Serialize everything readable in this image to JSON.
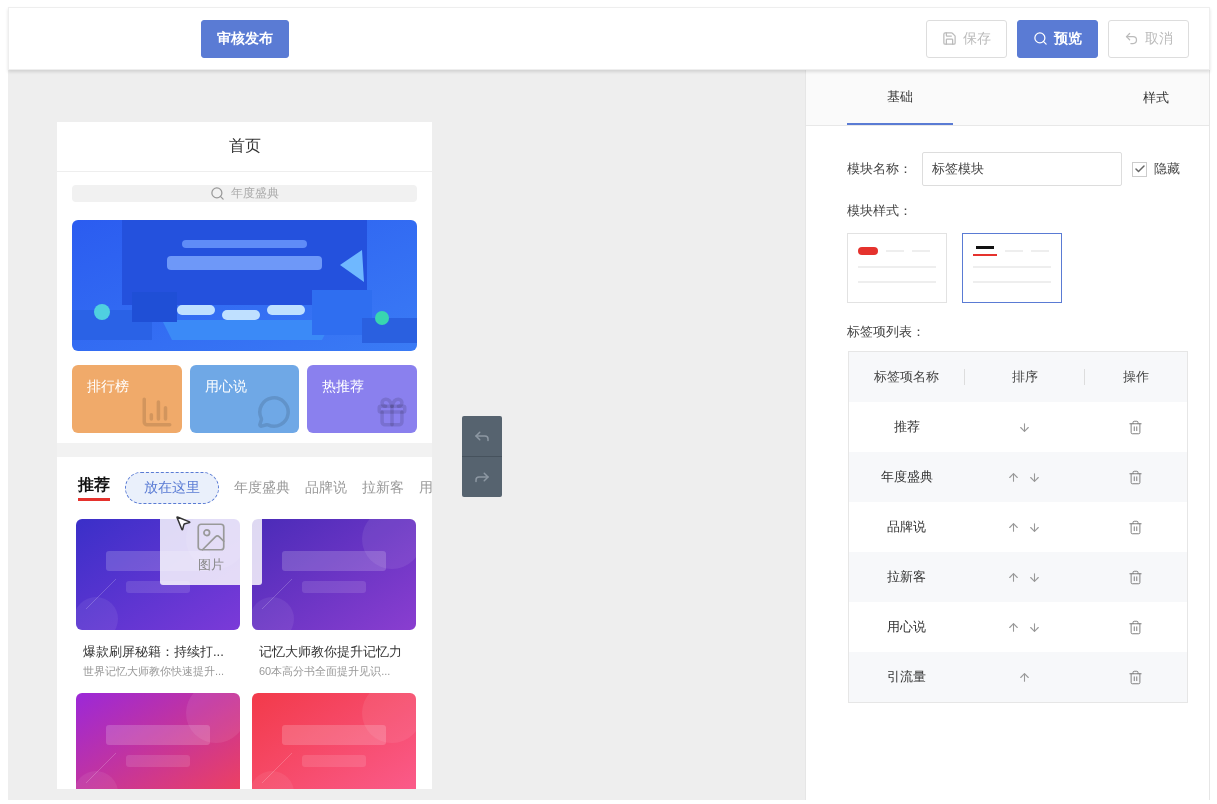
{
  "toolbar": {
    "publish_button": "审核发布",
    "buttons": [
      {
        "label": "保存",
        "kind": "save",
        "disabled": true
      },
      {
        "label": "预览",
        "kind": "preview",
        "disabled": false
      },
      {
        "label": "取消",
        "kind": "cancel",
        "disabled": true
      }
    ]
  },
  "phone": {
    "title": "首页",
    "search": {
      "placeholder": "年度盛典"
    },
    "banner": {
      "kind": "picture"
    },
    "shortcuts": [
      {
        "label": "排行榜",
        "kind": "chart",
        "color": "#f0aa6a"
      },
      {
        "label": "用心说",
        "kind": "chat",
        "color": "#6fa8e6"
      },
      {
        "label": "热推荐",
        "kind": "gift",
        "color": "#8a80ee"
      }
    ],
    "tabs": [
      {
        "label": "推荐",
        "kind": "tab",
        "selected": true
      },
      {
        "label": "放在这里",
        "kind": "drop",
        "selected": false
      },
      {
        "label": "年度盛典",
        "kind": "tab",
        "selected": false
      },
      {
        "label": "品牌说",
        "kind": "tab",
        "selected": false
      },
      {
        "label": "拉新客",
        "kind": "tab",
        "selected": false
      },
      {
        "label": "用",
        "kind": "tab",
        "selected": false
      }
    ],
    "drag_ghost": {
      "label": "图片"
    },
    "cards": [
      {
        "kind": "picture",
        "title": "爆款刷屏秘籍：持续打...",
        "subtitle": "世界记忆大师教你快速提升..."
      },
      {
        "kind": "picture",
        "title": "记忆大师教你提升记忆力",
        "subtitle": "60本高分书全面提升见识..."
      },
      {
        "kind": "picture"
      },
      {
        "kind": "picture"
      }
    ]
  },
  "panel": {
    "tabs": [
      {
        "label": "基础",
        "selected": true
      },
      {
        "label": "样式",
        "selected": false
      }
    ],
    "name_label": "模块名称：",
    "name_value": "标签模块",
    "hide": {
      "label": "隐藏",
      "checked": true
    },
    "style_label": "模块样式：",
    "styles": [
      {
        "kind": "pill",
        "selected": false
      },
      {
        "kind": "underline",
        "selected": true
      }
    ],
    "list_label": "标签项列表：",
    "table": {
      "columns": [
        "标签项名称",
        "排序",
        "操作"
      ],
      "rows": [
        {
          "name": "推荐",
          "up": false,
          "down": true
        },
        {
          "name": "年度盛典",
          "up": true,
          "down": true
        },
        {
          "name": "品牌说",
          "up": true,
          "down": true
        },
        {
          "name": "拉新客",
          "up": true,
          "down": true
        },
        {
          "name": "用心说",
          "up": true,
          "down": true
        },
        {
          "name": "引流量",
          "up": true,
          "down": false
        }
      ]
    }
  }
}
